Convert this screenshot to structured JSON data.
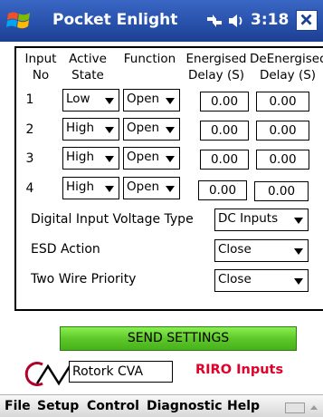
{
  "titlebar": {
    "app_title": "Pocket Enlight",
    "time": "3:18",
    "icons": [
      "windows-start-icon",
      "connectivity-icon",
      "volume-icon",
      "close-icon"
    ]
  },
  "table": {
    "headers": {
      "input_no": [
        "Input",
        "No"
      ],
      "active_state": [
        "Active",
        "State"
      ],
      "function": [
        "Function"
      ],
      "energised_delay": [
        "Energised",
        "Delay (S)"
      ],
      "deenergised_delay": [
        "DeEnergised",
        "Delay (S)"
      ]
    },
    "rows": [
      {
        "no": "1",
        "active_state": "Low",
        "function": "Open",
        "energised_delay": "0.00",
        "deenergised_delay": "0.00"
      },
      {
        "no": "2",
        "active_state": "High",
        "function": "Open",
        "energised_delay": "0.00",
        "deenergised_delay": "0.00"
      },
      {
        "no": "3",
        "active_state": "High",
        "function": "Open",
        "energised_delay": "0.00",
        "deenergised_delay": "0.00"
      },
      {
        "no": "4",
        "active_state": "High",
        "function": "Open",
        "energised_delay": "0.00",
        "deenergised_delay": "0.00"
      }
    ]
  },
  "settings": {
    "voltage_type_label": "Digital Input Voltage Type",
    "voltage_type_value": "DC Inputs",
    "esd_action_label": "ESD Action",
    "esd_action_value": "Close",
    "two_wire_label": "Two Wire Priority",
    "two_wire_value": "Close"
  },
  "send_button": "SEND SETTINGS",
  "footer": {
    "device_name": "Rotork CVA",
    "page_title": "RIRO Inputs"
  },
  "menu": [
    "File",
    "Setup",
    "Control",
    "Diagnostic",
    "Help"
  ],
  "colors": {
    "titlebar": "#2b55b0",
    "send_button": "#5ec72a",
    "page_title": "#e0002a"
  }
}
